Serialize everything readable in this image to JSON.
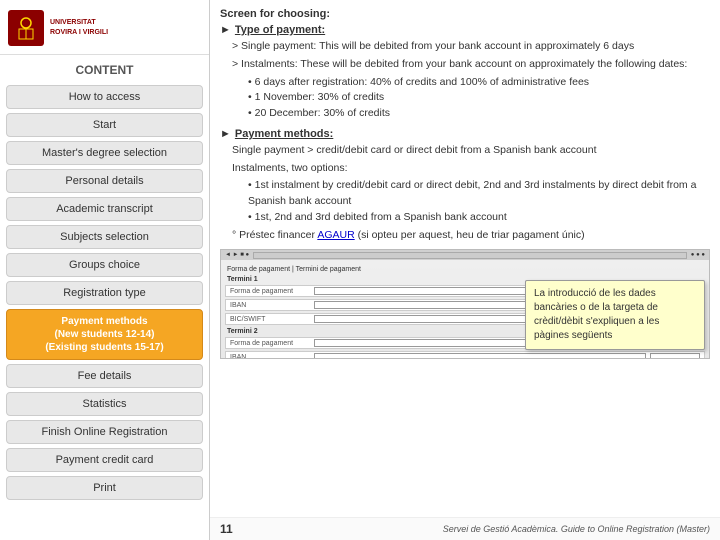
{
  "sidebar": {
    "content_label": "CONTENT",
    "logo_line1": "UNIVERSITAT",
    "logo_line2": "ROVIRA I VIRGILI",
    "items": [
      {
        "id": "how-to-access",
        "label": "How to access",
        "active": false,
        "orange": false
      },
      {
        "id": "start",
        "label": "Start",
        "active": false,
        "orange": false
      },
      {
        "id": "masters-degree-selection",
        "label": "Master's degree selection",
        "active": false,
        "orange": false
      },
      {
        "id": "personal-details",
        "label": "Personal details",
        "active": false,
        "orange": false
      },
      {
        "id": "academic-transcript",
        "label": "Academic transcript",
        "active": false,
        "orange": false
      },
      {
        "id": "subjects-selection",
        "label": "Subjects selection",
        "active": false,
        "orange": false
      },
      {
        "id": "groups-choice",
        "label": "Groups choice",
        "active": false,
        "orange": false
      },
      {
        "id": "registration-type",
        "label": "Registration type",
        "active": false,
        "orange": false
      },
      {
        "id": "payment-methods",
        "label": "Payment methods\n(New students 12-14)\n(Existing students 15-17)",
        "active": true,
        "orange": true
      },
      {
        "id": "fee-details",
        "label": "Fee details",
        "active": false,
        "orange": false
      },
      {
        "id": "statistics",
        "label": "Statistics",
        "active": false,
        "orange": false
      },
      {
        "id": "finish-online-registration",
        "label": "Finish Online Registration",
        "active": false,
        "orange": false
      },
      {
        "id": "payment-credit-card",
        "label": "Payment credit card",
        "active": false,
        "orange": false
      },
      {
        "id": "print",
        "label": "Print",
        "active": false,
        "orange": false
      }
    ]
  },
  "main": {
    "screen_for_choosing": "Screen for choosing:",
    "section1": {
      "arrow": "►",
      "title": "Type of payment:",
      "items": [
        "> Single payment: This will be debited from your bank account in approximately 6 days",
        "> Instalments: These will be debited from your bank account on approximately the following dates:"
      ],
      "subitems": [
        "6 days after registration: 40% of credits and 100% of administrative fees",
        "1 November: 30% of credits",
        "20 December: 30% of credits"
      ]
    },
    "section2": {
      "arrow": "►",
      "title": "Payment methods:",
      "line1": "Single payment > credit/debit card or direct debit from a Spanish bank account",
      "line2": "Instalments, two options:",
      "subitems": [
        "1st instalment by credit/debit card or direct debit, 2nd and 3rd instalments by direct debit from a Spanish bank account",
        "1st, 2nd and 3rd debited from a Spanish bank account"
      ],
      "last_item": "° Préstec financer AGAUR (si opteu per aquest, heu de triar pagament únic)",
      "link_text": "AGAUR"
    },
    "tooltip": {
      "text": "La introducció de les dades bancàries o de la targeta de crèdit/dèbit s'expliquen a les pàgines següents"
    },
    "footer": {
      "page_number": "11",
      "footer_text": "Servei de Gestió Acadèmica. Guide to Online Registration (Master)"
    }
  }
}
